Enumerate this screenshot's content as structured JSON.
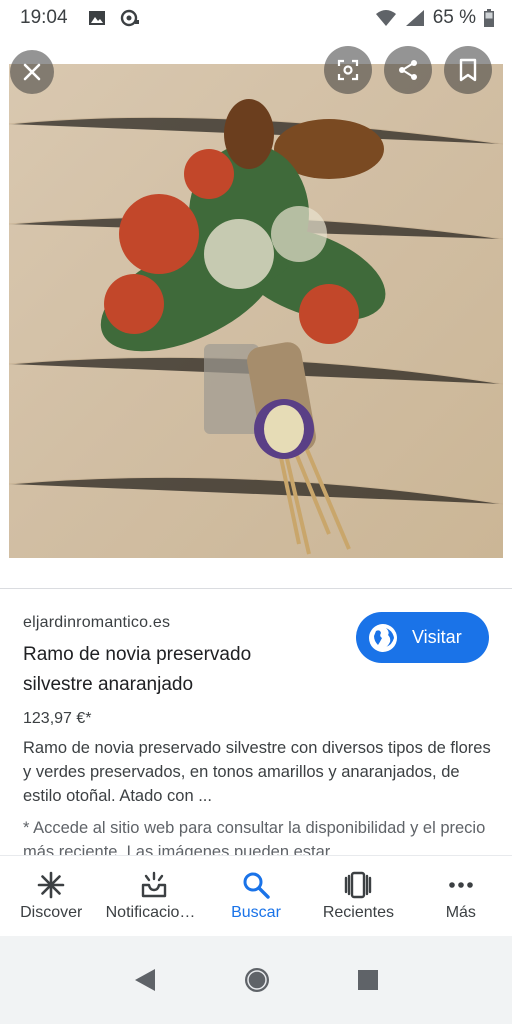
{
  "status_bar": {
    "time": "19:04",
    "battery": "65 %"
  },
  "image_viewer": {
    "close_icon": "close-icon",
    "lens_icon": "lens-icon",
    "share_icon": "share-icon",
    "save_icon": "bookmark-icon"
  },
  "result": {
    "domain": "eljardinromantico.es",
    "title": "Ramo de novia preservado silvestre anaranjado",
    "visit_label": "Visitar",
    "price": "123,97 €*",
    "description": "Ramo de novia preservado silvestre con diversos tipos de flores y verdes preservados, en tonos amarillos y anaranjados, de estilo otoñal. Atado con ...",
    "notice": "* Accede al sitio web para consultar la disponibilidad y el precio más reciente. Las imágenes pueden estar"
  },
  "bottom_nav": {
    "items": [
      {
        "label": "Discover",
        "icon": "discover-icon"
      },
      {
        "label": "Notificaciones",
        "icon": "notifications-icon"
      },
      {
        "label": "Buscar",
        "icon": "search-icon"
      },
      {
        "label": "Recientes",
        "icon": "recents-icon"
      },
      {
        "label": "Más",
        "icon": "more-icon"
      }
    ],
    "active": "Buscar"
  },
  "colors": {
    "accent": "#1a73e8",
    "text": "#202124",
    "muted": "#5f6368"
  }
}
